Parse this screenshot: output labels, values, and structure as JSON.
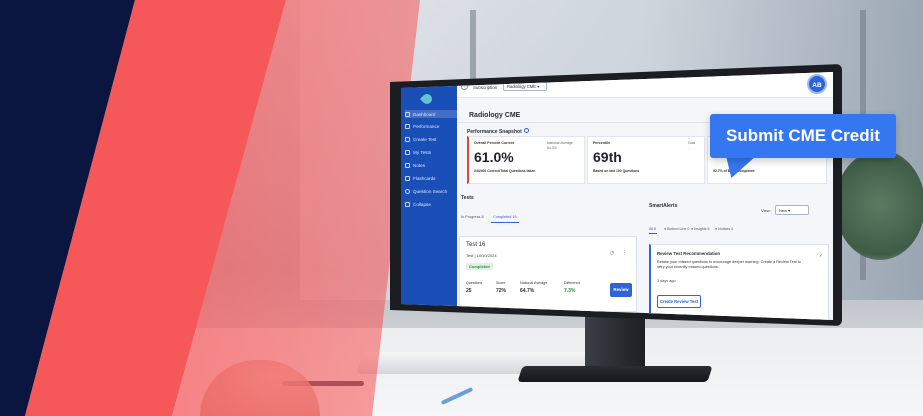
{
  "app": {
    "subscription_label": "Subscription",
    "subscription_value": "Radiology CME",
    "avatar_initials": "AB",
    "page_title": "Radiology CME"
  },
  "sidebar": {
    "items": [
      {
        "label": "Dashboard",
        "icon": "dashboard-icon"
      },
      {
        "label": "Performance",
        "icon": "chart-icon"
      },
      {
        "label": "Create Test",
        "icon": "plus-icon"
      },
      {
        "label": "My Tests",
        "icon": "list-icon"
      },
      {
        "label": "Notes",
        "icon": "note-icon"
      },
      {
        "label": "Flashcards",
        "icon": "card-icon"
      },
      {
        "label": "Question Search",
        "icon": "search-icon"
      },
      {
        "label": "Collapse",
        "icon": "collapse-icon"
      }
    ]
  },
  "performance": {
    "title": "Performance Snapshot",
    "overall": {
      "label": "Overall Percent Correct",
      "value": "61.0%",
      "detail": "244/400 Correct/Total Questions taken",
      "national_label": "National Average",
      "national_value": "64.3%"
    },
    "percentile": {
      "label": "Percentile",
      "value": "69th",
      "detail": "Based on last 100 Questions",
      "goal_label": "Goal",
      "goal_value": "-"
    },
    "bank": {
      "detail": "92.7% of Bank Completed"
    }
  },
  "tests": {
    "title": "Tests",
    "tabs": [
      "In Progress 8",
      "Completed 16"
    ],
    "card": {
      "title": "Test 16",
      "date": "Test | 10/10/2024",
      "status": "Completed",
      "headers": [
        "Questions",
        "Score",
        "National Average",
        "Difference"
      ],
      "values": [
        "25",
        "72%",
        "64.7%",
        "7.3%"
      ],
      "button": "Review"
    }
  },
  "smart_alerts": {
    "title": "SmartAlerts",
    "view_label": "View:",
    "view_value": "New",
    "tabs": [
      "All 8",
      "Bottom Line 0",
      "Insights 5",
      "Notices 0"
    ],
    "card": {
      "title": "Review Test Recommendation",
      "body": "Retake your missed questions to encourage deeper learning. Create a Review Test to retry your recently missed questions.",
      "time": "3 days ago",
      "button": "Create Review Test"
    }
  },
  "cta": {
    "label": "Submit CME Credit"
  },
  "colors": {
    "navy": "#0b1640",
    "coral": "#f6585a",
    "primary_blue": "#3477f0",
    "sidebar_blue": "#1b4fb8"
  }
}
